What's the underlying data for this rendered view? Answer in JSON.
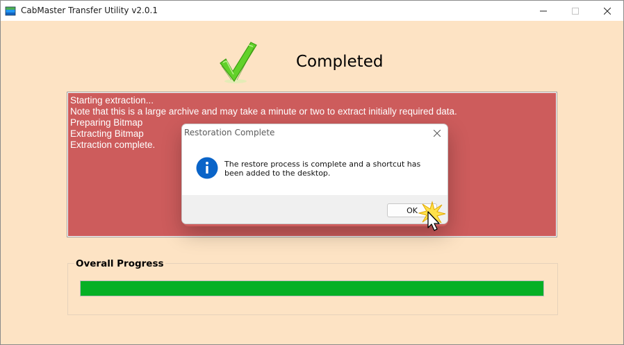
{
  "window": {
    "title": "CabMaster Transfer Utility v2.0.1",
    "icons": {
      "app": "package-stack-icon",
      "minimize": "minimize-icon",
      "maximize": "maximize-icon",
      "close": "close-icon"
    }
  },
  "main": {
    "status_icon": "green-checkmark-icon",
    "heading": "Completed",
    "log_lines": [
      "Starting extraction...",
      "Note that this is a large archive and may take a minute or two to extract initially required data.",
      "Preparing Bitmap",
      "Extracting Bitmap",
      "Extraction complete."
    ],
    "log_background": "#cd5c5c"
  },
  "progress": {
    "label": "Overall Progress",
    "value_fraction": 1.0,
    "fill_color": "#06b025"
  },
  "dialog": {
    "title": "Restoration Complete",
    "icon": "info-icon",
    "message": "The restore process is complete and a shortcut has been added to the desktop.",
    "ok_label": "OK",
    "accent": "#0a64c8"
  }
}
